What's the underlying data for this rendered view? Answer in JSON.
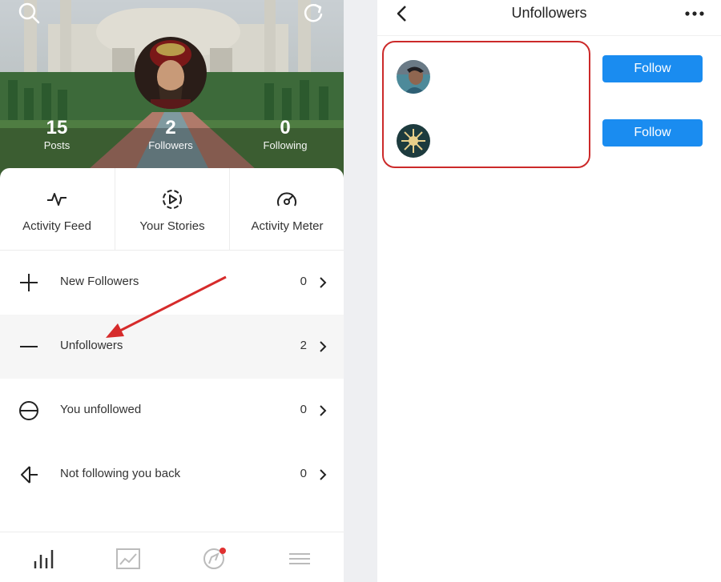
{
  "left": {
    "header": {
      "search_icon": "search-icon",
      "refresh_icon": "refresh-icon"
    },
    "stats": [
      {
        "value": "15",
        "label": "Posts"
      },
      {
        "value": "2",
        "label": "Followers"
      },
      {
        "value": "0",
        "label": "Following"
      }
    ],
    "tiles": [
      {
        "label": "Activity Feed",
        "icon": "pulse-icon"
      },
      {
        "label": "Your Stories",
        "icon": "play-circle-icon"
      },
      {
        "label": "Activity Meter",
        "icon": "meter-icon"
      }
    ],
    "rows": [
      {
        "label": "New Followers",
        "count": "0",
        "icon": "plus-icon"
      },
      {
        "label": "Unfollowers",
        "count": "2",
        "icon": "minus-icon"
      },
      {
        "label": "You unfollowed",
        "count": "0",
        "icon": "circle-minus-icon"
      },
      {
        "label": "Not following you back",
        "count": "0",
        "icon": "arrow-left-icon"
      }
    ],
    "tabs": [
      "bar-chart-icon",
      "line-chart-icon",
      "compass-icon",
      "menu-icon"
    ],
    "colors": {
      "notification_dot": "#e03030",
      "annotation": "#d62b2b"
    }
  },
  "right": {
    "title": "Unfollowers",
    "users": [
      {
        "follow_label": "Follow"
      },
      {
        "follow_label": "Follow"
      }
    ],
    "colors": {
      "follow_button": "#1a8cf0",
      "highlight_box": "#cc2a2a"
    }
  }
}
